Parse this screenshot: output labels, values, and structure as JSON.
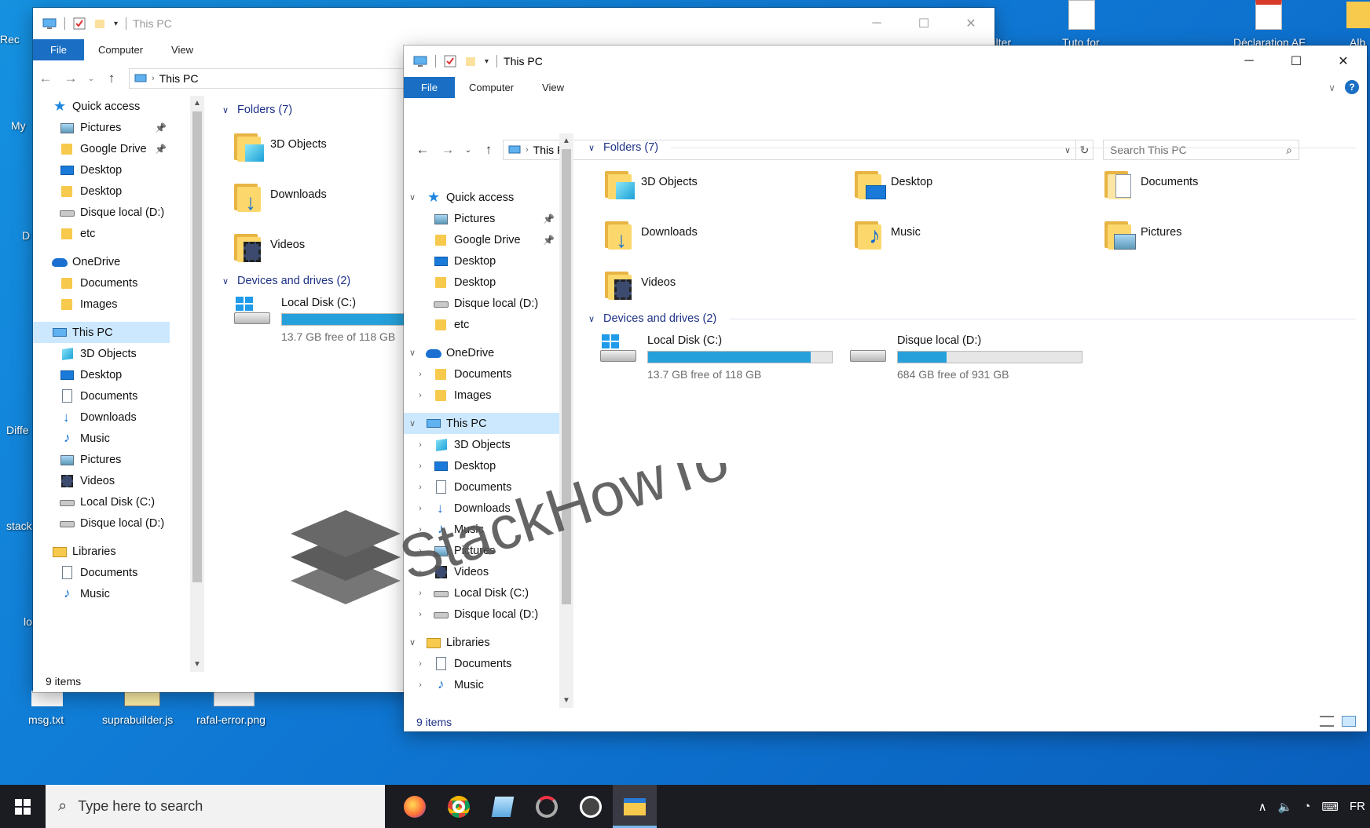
{
  "desktop": {
    "labels": {
      "recycle": "Rec",
      "mypc": "My",
      "d": "D",
      "diff": "Diffe",
      "stack": "stack",
      "w": "lo",
      "filter": "Filter",
      "tuto": "Tuto for",
      "declaration": "Déclaration AF",
      "album": "Alb",
      "msg": "msg.txt",
      "supra": "suprabuilder.js",
      "rafal": "rafal-error.png"
    }
  },
  "back_window": {
    "title": "This PC",
    "ribbon_tabs": [
      "File",
      "Computer",
      "View"
    ],
    "address": "This PC",
    "nav": [
      {
        "label": "Quick access",
        "icon": "star-icon"
      },
      {
        "label": "Pictures",
        "icon": "pictures-icon",
        "pinned": true
      },
      {
        "label": "Google Drive",
        "icon": "folder-icon",
        "pinned": true
      },
      {
        "label": "Desktop",
        "icon": "desktop-icon"
      },
      {
        "label": "Desktop",
        "icon": "folder-icon"
      },
      {
        "label": "Disque local (D:)",
        "icon": "drive-icon"
      },
      {
        "label": "etc",
        "icon": "folder-icon"
      },
      {
        "label": "OneDrive",
        "icon": "cloud-icon"
      },
      {
        "label": "Documents",
        "icon": "folder-icon"
      },
      {
        "label": "Images",
        "icon": "folder-icon"
      },
      {
        "label": "This PC",
        "icon": "pc-icon"
      },
      {
        "label": "3D Objects",
        "icon": "cube-icon"
      },
      {
        "label": "Desktop",
        "icon": "desktop-icon"
      },
      {
        "label": "Documents",
        "icon": "document-icon"
      },
      {
        "label": "Downloads",
        "icon": "download-icon"
      },
      {
        "label": "Music",
        "icon": "music-icon"
      },
      {
        "label": "Pictures",
        "icon": "pictures-icon"
      },
      {
        "label": "Videos",
        "icon": "video-icon"
      },
      {
        "label": "Local Disk (C:)",
        "icon": "drive-icon"
      },
      {
        "label": "Disque local (D:)",
        "icon": "drive-icon"
      },
      {
        "label": "Libraries",
        "icon": "library-icon"
      },
      {
        "label": "Documents",
        "icon": "document-icon"
      },
      {
        "label": "Music",
        "icon": "music-icon"
      }
    ],
    "folders_header": "Folders (7)",
    "folders": [
      "3D Objects",
      "Downloads",
      "Videos"
    ],
    "drives_header": "Devices and drives (2)",
    "drive": {
      "name": "Local Disk (C:)",
      "free": "13.7 GB free of 118 GB",
      "used_fraction": 0.884
    },
    "status": "9 items"
  },
  "front_window": {
    "title": "This PC",
    "ribbon_tabs": [
      "File",
      "Computer",
      "View"
    ],
    "address": "This PC",
    "search_placeholder": "Search This PC",
    "nav": [
      {
        "label": "Quick access",
        "icon": "star-icon",
        "chevron": "expanded",
        "level": 0
      },
      {
        "label": "Pictures",
        "icon": "pictures-icon",
        "pinned": true,
        "level": 1
      },
      {
        "label": "Google Drive",
        "icon": "folder-icon",
        "pinned": true,
        "level": 1
      },
      {
        "label": "Desktop",
        "icon": "desktop-icon",
        "level": 1
      },
      {
        "label": "Desktop",
        "icon": "folder-icon",
        "level": 1
      },
      {
        "label": "Disque local (D:)",
        "icon": "drive-icon",
        "level": 1
      },
      {
        "label": "etc",
        "icon": "folder-icon",
        "level": 1
      },
      {
        "label": "OneDrive",
        "icon": "cloud-icon",
        "chevron": "expanded",
        "level": 0
      },
      {
        "label": "Documents",
        "icon": "folder-icon",
        "chevron": "collapsed",
        "level": 1
      },
      {
        "label": "Images",
        "icon": "folder-icon",
        "chevron": "collapsed",
        "level": 1
      },
      {
        "label": "This PC",
        "icon": "pc-icon",
        "chevron": "expanded",
        "level": 0,
        "selected": true
      },
      {
        "label": "3D Objects",
        "icon": "cube-icon",
        "chevron": "collapsed",
        "level": 1
      },
      {
        "label": "Desktop",
        "icon": "desktop-icon",
        "chevron": "collapsed",
        "level": 1
      },
      {
        "label": "Documents",
        "icon": "document-icon",
        "chevron": "collapsed",
        "level": 1
      },
      {
        "label": "Downloads",
        "icon": "download-icon",
        "chevron": "collapsed",
        "level": 1
      },
      {
        "label": "Music",
        "icon": "music-icon",
        "chevron": "collapsed",
        "level": 1
      },
      {
        "label": "Pictures",
        "icon": "pictures-icon",
        "chevron": "collapsed",
        "level": 1
      },
      {
        "label": "Videos",
        "icon": "video-icon",
        "chevron": "collapsed",
        "level": 1
      },
      {
        "label": "Local Disk (C:)",
        "icon": "drive-icon",
        "chevron": "collapsed",
        "level": 1
      },
      {
        "label": "Disque local (D:)",
        "icon": "drive-icon",
        "chevron": "collapsed",
        "level": 1
      },
      {
        "label": "Libraries",
        "icon": "library-icon",
        "chevron": "expanded",
        "level": 0
      },
      {
        "label": "Documents",
        "icon": "document-icon",
        "chevron": "collapsed",
        "level": 1
      },
      {
        "label": "Music",
        "icon": "music-icon",
        "chevron": "collapsed",
        "level": 1
      }
    ],
    "folders_header": "Folders (7)",
    "folders": [
      {
        "label": "3D Objects",
        "icon": "3d-objects-folder-icon"
      },
      {
        "label": "Desktop",
        "icon": "desktop-folder-icon"
      },
      {
        "label": "Documents",
        "icon": "documents-folder-icon"
      },
      {
        "label": "Downloads",
        "icon": "downloads-folder-icon"
      },
      {
        "label": "Music",
        "icon": "music-folder-icon"
      },
      {
        "label": "Pictures",
        "icon": "pictures-folder-icon"
      },
      {
        "label": "Videos",
        "icon": "videos-folder-icon"
      }
    ],
    "drives_header": "Devices and drives (2)",
    "drives": [
      {
        "name": "Local Disk (C:)",
        "free": "13.7 GB free of 118 GB",
        "used_fraction": 0.884,
        "icon": "windows-drive-icon"
      },
      {
        "name": "Disque local (D:)",
        "free": "684 GB free of 931 GB",
        "used_fraction": 0.265,
        "icon": "drive-icon"
      }
    ],
    "status": "9 items"
  },
  "taskbar": {
    "search_placeholder": "Type here to search",
    "apps": [
      "firefox-icon",
      "chrome-icon",
      "notepad-icon",
      "davinci-icon",
      "obs-icon",
      "file-explorer-icon"
    ],
    "tray_lang": "FR"
  },
  "watermark": {
    "text": "StackHowTo"
  },
  "colors": {
    "accent": "#1a6fc4",
    "selection": "#cce8ff",
    "bar_fill": "#26a0da",
    "group_header": "#1e3287"
  }
}
